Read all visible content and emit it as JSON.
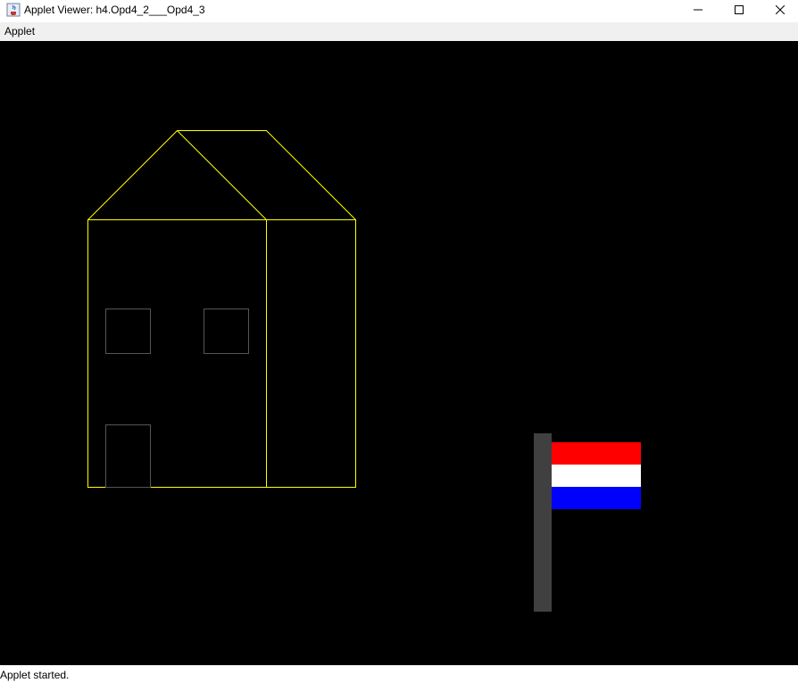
{
  "window": {
    "title": "Applet Viewer: h4.Opd4_2___Opd4_3",
    "icon": "java-icon"
  },
  "menubar": {
    "items": [
      {
        "label": "Applet"
      }
    ]
  },
  "canvas": {
    "background": "#000000",
    "house": {
      "outline_color": "#ffff00",
      "window_color": "#555555",
      "door_color": "#555555"
    },
    "flag": {
      "pole_color": "#404040",
      "stripes": [
        "#ff0000",
        "#ffffff",
        "#0000ff"
      ]
    }
  },
  "statusbar": {
    "text": "Applet started."
  }
}
